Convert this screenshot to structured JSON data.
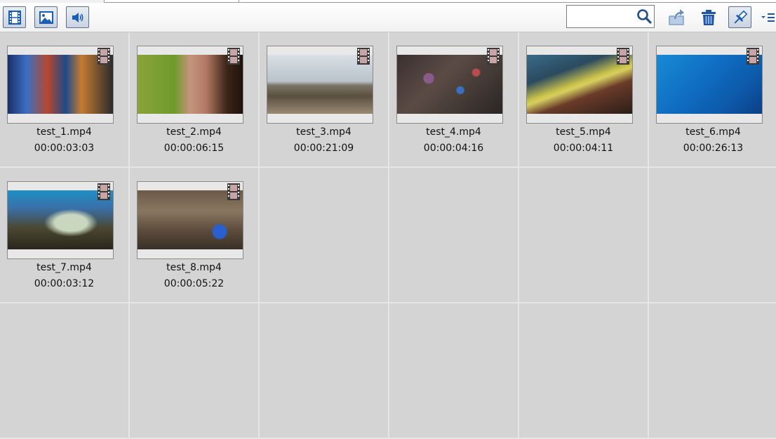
{
  "toolbar": {
    "search": {
      "value": "",
      "placeholder": ""
    },
    "buttons": [
      "video-filter",
      "image-filter",
      "audio-filter",
      "export",
      "delete",
      "pin",
      "menu"
    ]
  },
  "colors": {
    "accent": "#1b5fb4",
    "background": "#d4d4d4",
    "grid_line": "#e6e6e6"
  },
  "media": [
    {
      "name": "test_1.mp4",
      "duration": "00:00:03:03",
      "icon": "film-icon"
    },
    {
      "name": "test_2.mp4",
      "duration": "00:00:06:15",
      "icon": "film-icon"
    },
    {
      "name": "test_3.mp4",
      "duration": "00:00:21:09",
      "icon": "film-icon"
    },
    {
      "name": "test_4.mp4",
      "duration": "00:00:04:16",
      "icon": "film-icon"
    },
    {
      "name": "test_5.mp4",
      "duration": "00:00:04:11",
      "icon": "film-icon"
    },
    {
      "name": "test_6.mp4",
      "duration": "00:00:26:13",
      "icon": "film-icon"
    },
    {
      "name": "test_7.mp4",
      "duration": "00:00:03:12",
      "icon": "film-icon"
    },
    {
      "name": "test_8.mp4",
      "duration": "00:00:05:22",
      "icon": "film-icon"
    }
  ]
}
